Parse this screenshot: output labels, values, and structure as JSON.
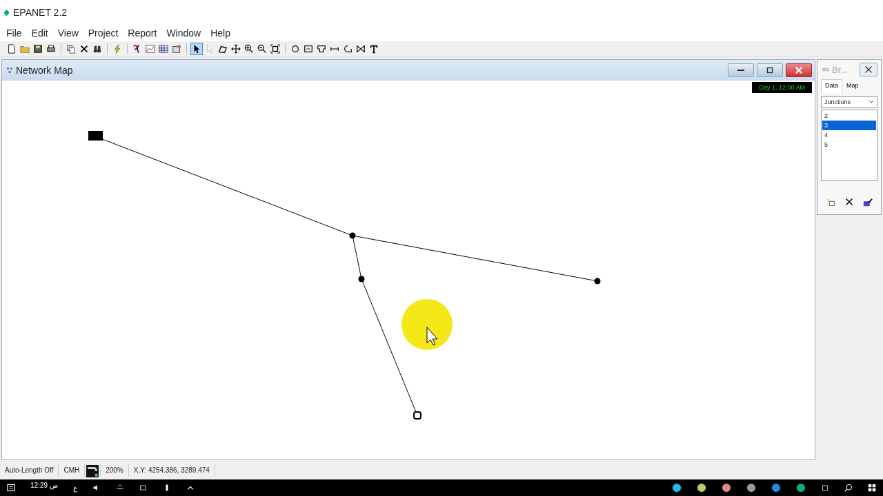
{
  "app": {
    "title": "EPANET 2.2"
  },
  "menu": [
    "File",
    "Edit",
    "View",
    "Project",
    "Report",
    "Window",
    "Help"
  ],
  "toolbar": [
    {
      "kind": "new",
      "selected": false
    },
    {
      "kind": "open",
      "selected": false
    },
    {
      "kind": "save",
      "selected": false
    },
    {
      "kind": "print",
      "selected": false
    },
    {
      "kind": "sep"
    },
    {
      "kind": "copy",
      "selected": false
    },
    {
      "kind": "delete",
      "selected": false
    },
    {
      "kind": "find",
      "selected": false
    },
    {
      "kind": "sep"
    },
    {
      "kind": "run",
      "selected": false
    },
    {
      "kind": "sep"
    },
    {
      "kind": "query",
      "selected": false
    },
    {
      "kind": "graph",
      "selected": false
    },
    {
      "kind": "table",
      "selected": false
    },
    {
      "kind": "options",
      "selected": false
    },
    {
      "kind": "sep"
    },
    {
      "kind": "select",
      "selected": true
    },
    {
      "kind": "vertex",
      "selected": false
    },
    {
      "kind": "region",
      "selected": false
    },
    {
      "kind": "pan",
      "selected": false
    },
    {
      "kind": "zoomin",
      "selected": false
    },
    {
      "kind": "zoomout",
      "selected": false
    },
    {
      "kind": "extent",
      "selected": false
    },
    {
      "kind": "sep"
    },
    {
      "kind": "junction",
      "selected": false
    },
    {
      "kind": "reservoir",
      "selected": false
    },
    {
      "kind": "tank",
      "selected": false
    },
    {
      "kind": "pipe",
      "selected": false
    },
    {
      "kind": "pump",
      "selected": false
    },
    {
      "kind": "valve",
      "selected": false
    },
    {
      "kind": "label",
      "selected": false
    }
  ],
  "map_window": {
    "title": "Network Map",
    "time": "Day 1, 12:00 AM",
    "nodes": [
      {
        "kind": "reservoir"
      },
      {
        "kind": "junction"
      },
      {
        "kind": "junction"
      },
      {
        "kind": "junction"
      },
      {
        "kind": "tank"
      }
    ],
    "links": [
      {
        "kind": "pipe"
      },
      {
        "kind": "pipe"
      },
      {
        "kind": "pipe"
      },
      {
        "kind": "pipe"
      }
    ]
  },
  "browser": {
    "title": "Br...",
    "tabs": [
      {
        "label": "Data",
        "selected": true
      },
      {
        "label": "Map",
        "selected": false
      }
    ],
    "category": "Junctions",
    "items": [
      {
        "label": "2",
        "selected": false
      },
      {
        "label": "3",
        "selected": true
      },
      {
        "label": "4",
        "selected": false
      },
      {
        "label": "5",
        "selected": false
      }
    ]
  },
  "status_bar": {
    "auto_length": "Auto-Length Off",
    "units": "CMH",
    "zoom": "200%",
    "xy": "X,Y: 4254.386, 3289.474"
  },
  "taskbar": {
    "clock": "12:29",
    "ampm": "ص",
    "language": "ع"
  }
}
